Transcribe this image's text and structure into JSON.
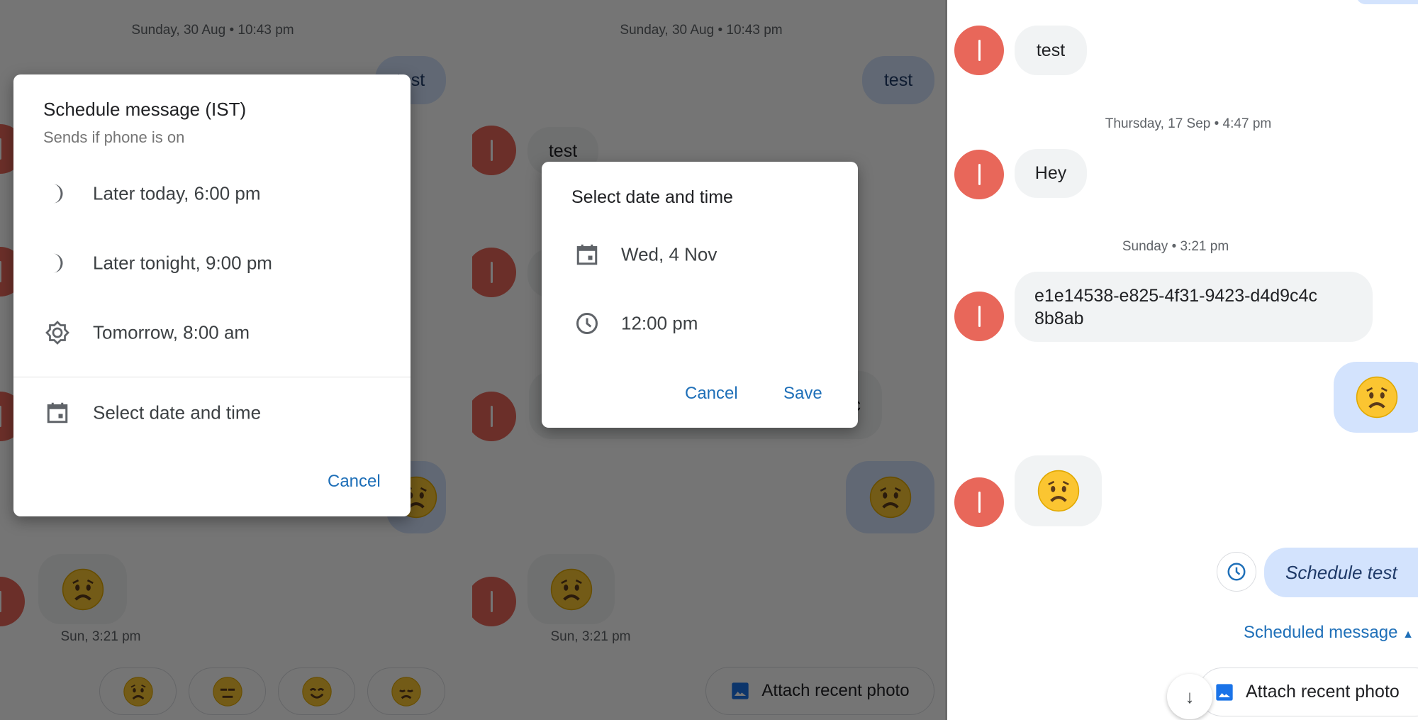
{
  "colors": {
    "accent": "#1e6fb8",
    "avatar": "#e8675a",
    "incoming_bubble": "#f1f3f4",
    "outgoing_bubble": "#d3e3fd"
  },
  "panel1": {
    "timestamp": "Sunday, 30 Aug • 10:43 pm",
    "out_text": "test",
    "msg_time": "Sun, 3:21 pm",
    "dialog": {
      "title": "Schedule message (IST)",
      "subtitle": "Sends if phone is on",
      "options": [
        {
          "icon": "moon-icon",
          "label": "Later today, 6:00 pm"
        },
        {
          "icon": "moon-icon",
          "label": "Later tonight, 9:00 pm"
        },
        {
          "icon": "sun-icon",
          "label": "Tomorrow, 8:00 am"
        },
        {
          "icon": "calendar-icon",
          "label": "Select date and time"
        }
      ],
      "cancel": "Cancel"
    },
    "smart_replies": [
      "worried",
      "expressionless",
      "smiling",
      "disappointed"
    ]
  },
  "panel2": {
    "timestamp": "Sunday, 30 Aug • 10:43 pm",
    "out_text": "test",
    "in_text": "test",
    "hidden_text_fragment": "c",
    "msg_time": "Sun, 3:21 pm",
    "attach": "Attach recent photo",
    "dialog": {
      "title": "Select date and time",
      "date": "Wed, 4 Nov",
      "time": "12:00 pm",
      "cancel": "Cancel",
      "save": "Save"
    }
  },
  "panel3": {
    "messages": [
      {
        "text": "test"
      },
      {
        "timestamp": "Thursday, 17 Sep • 4:47 pm"
      },
      {
        "text": "Hey"
      },
      {
        "timestamp": "Sunday • 3:21 pm"
      },
      {
        "line1": "e1e14538-e825-4f31-9423-d4d9c4c",
        "line2": "8b8ab"
      }
    ],
    "scheduled_text": "Schedule test",
    "scheduled_label": "Scheduled message",
    "attach": "Attach recent photo"
  }
}
